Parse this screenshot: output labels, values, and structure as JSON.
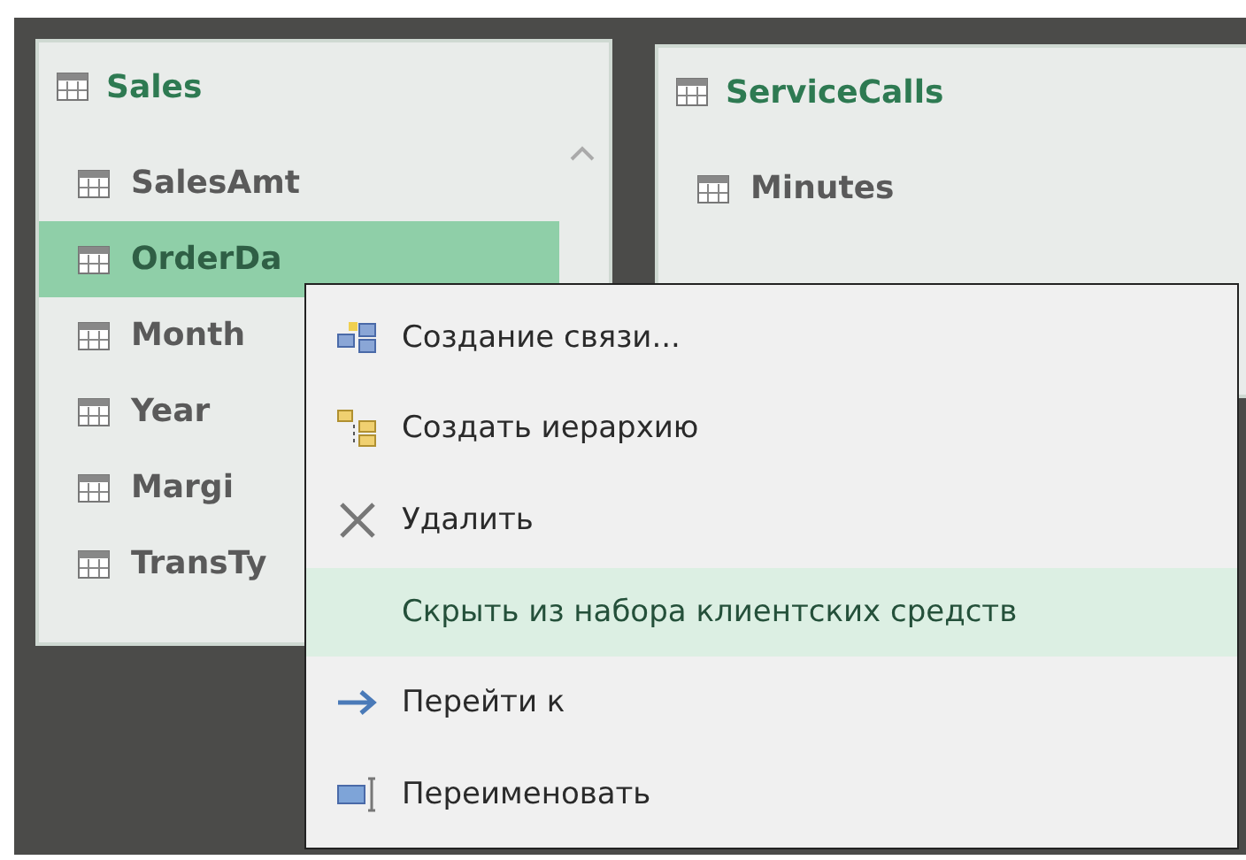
{
  "tables": [
    {
      "title": "Sales",
      "columns": [
        {
          "label": "SalesAmt",
          "selected": false
        },
        {
          "label": "OrderDa",
          "selected": true
        },
        {
          "label": "Month",
          "selected": false
        },
        {
          "label": "Year",
          "selected": false
        },
        {
          "label": "Margi",
          "selected": false
        },
        {
          "label": "TransTy",
          "selected": false
        }
      ]
    },
    {
      "title": "ServiceCalls",
      "columns": [
        {
          "label": "Minutes",
          "selected": false
        }
      ]
    }
  ],
  "context_menu": [
    {
      "label": "Создание связи...",
      "kind": "relation",
      "selected": false
    },
    {
      "label": "Создать иерархию",
      "kind": "hierarchy",
      "selected": false
    },
    {
      "label": "Удалить",
      "kind": "delete",
      "selected": false
    },
    {
      "label": "Скрыть из набора клиентских средств",
      "kind": "plain",
      "selected": true
    },
    {
      "label": "Перейти к",
      "kind": "goto",
      "selected": false
    },
    {
      "label": "Переименовать",
      "kind": "rename",
      "selected": false
    }
  ]
}
